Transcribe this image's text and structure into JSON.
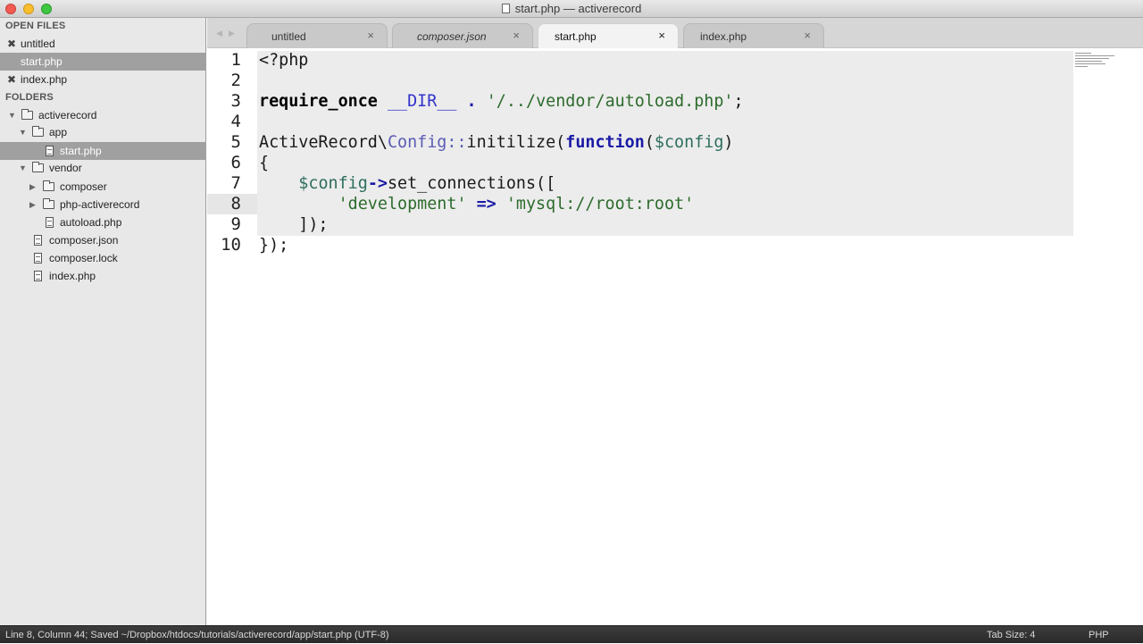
{
  "window": {
    "title": "start.php — activerecord"
  },
  "sidebar": {
    "open_files_header": "OPEN FILES",
    "open_files": [
      {
        "label": "untitled"
      },
      {
        "label": "start.php"
      },
      {
        "label": "index.php"
      }
    ],
    "folders_header": "FOLDERS",
    "tree": [
      {
        "label": "activerecord"
      },
      {
        "label": "app"
      },
      {
        "label": "start.php"
      },
      {
        "label": "vendor"
      },
      {
        "label": "composer"
      },
      {
        "label": "php-activerecord"
      },
      {
        "label": "autoload.php"
      },
      {
        "label": "composer.json"
      },
      {
        "label": "composer.lock"
      },
      {
        "label": "index.php"
      }
    ]
  },
  "tabs": [
    {
      "label": "untitled",
      "close": "×"
    },
    {
      "label": "composer.json",
      "close": "×"
    },
    {
      "label": "start.php",
      "close": "×"
    },
    {
      "label": "index.php",
      "close": "×"
    }
  ],
  "editor": {
    "line_numbers": [
      "1",
      "2",
      "3",
      "4",
      "5",
      "6",
      "7",
      "8",
      "9",
      "10"
    ],
    "lines": [
      [
        {
          "t": "plain",
          "v": "<?php"
        }
      ],
      [],
      [
        {
          "t": "kw",
          "v": "require_once"
        },
        {
          "t": "plain",
          "v": " "
        },
        {
          "t": "const",
          "v": "__DIR__"
        },
        {
          "t": "plain",
          "v": " "
        },
        {
          "t": "op",
          "v": "."
        },
        {
          "t": "plain",
          "v": " "
        },
        {
          "t": "str",
          "v": "'/../vendor/autoload.php'"
        },
        {
          "t": "plain",
          "v": ";"
        }
      ],
      [],
      [
        {
          "t": "plain",
          "v": "ActiveRecord\\"
        },
        {
          "t": "cls",
          "v": "Config::"
        },
        {
          "t": "plain",
          "v": "initilize("
        },
        {
          "t": "fn",
          "v": "function"
        },
        {
          "t": "plain",
          "v": "("
        },
        {
          "t": "var",
          "v": "$config"
        },
        {
          "t": "plain",
          "v": ")"
        }
      ],
      [
        {
          "t": "plain",
          "v": "{"
        }
      ],
      [
        {
          "t": "plain",
          "v": "    "
        },
        {
          "t": "var",
          "v": "$config"
        },
        {
          "t": "op",
          "v": "->"
        },
        {
          "t": "plain",
          "v": "set_connections(["
        }
      ],
      [
        {
          "t": "plain",
          "v": "        "
        },
        {
          "t": "str",
          "v": "'development'"
        },
        {
          "t": "plain",
          "v": " "
        },
        {
          "t": "op",
          "v": "=>"
        },
        {
          "t": "plain",
          "v": " "
        },
        {
          "t": "str",
          "v": "'mysql://root:root'"
        }
      ],
      [
        {
          "t": "plain",
          "v": "    ]);"
        }
      ],
      [
        {
          "t": "plain",
          "v": "});"
        }
      ]
    ]
  },
  "status": {
    "left": "Line 8, Column 44; Saved ~/Dropbox/htdocs/tutorials/activerecord/app/start.php (UTF-8)",
    "tab_size": "Tab Size: 4",
    "syntax": "PHP"
  }
}
